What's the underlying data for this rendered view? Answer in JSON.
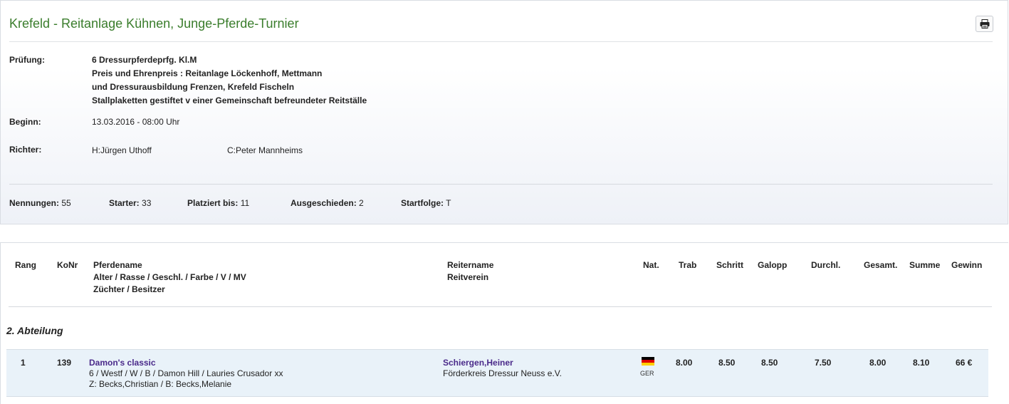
{
  "header": {
    "title": "Krefeld - Reitanlage Kühnen, Junge-Pferde-Turnier",
    "print_icon": "printer-icon"
  },
  "info": {
    "pruefung_label": "Prüfung:",
    "pruefung_lines": [
      "6 Dressurpferdeprfg. Kl.M",
      "Preis und Ehrenpreis : Reitanlage Löckenhoff, Mettmann",
      "und Dressurausbildung Frenzen, Krefeld Fischeln",
      "Stallplaketten gestiftet v einer Gemeinschaft befreundeter Reitställe"
    ],
    "beginn_label": "Beginn:",
    "beginn_value": "13.03.2016 - 08:00 Uhr",
    "richter_label": "Richter:",
    "richter_h": "H:Jürgen Uthoff",
    "richter_c": "C:Peter Mannheims"
  },
  "stats": {
    "nennungen_label": "Nennungen:",
    "nennungen_value": "55",
    "starter_label": "Starter:",
    "starter_value": "33",
    "platziert_label": "Platziert bis:",
    "platziert_value": "11",
    "ausgeschieden_label": "Ausgeschieden:",
    "ausgeschieden_value": "2",
    "startfolge_label": "Startfolge:",
    "startfolge_value": "T"
  },
  "table": {
    "headers": {
      "rang": "Rang",
      "konr": "KoNr",
      "pferd_1": "Pferdename",
      "pferd_2": "Alter / Rasse / Geschl. / Farbe / V / MV",
      "pferd_3": "Züchter / Besitzer",
      "reiter_1": "Reitername",
      "reiter_2": "Reitverein",
      "nat": "Nat.",
      "trab": "Trab",
      "schritt": "Schritt",
      "galopp": "Galopp",
      "durchl": "Durchl.",
      "gesamt": "Gesamt.",
      "summe": "Summe",
      "gewinn": "Gewinn"
    },
    "section_title": "2. Abteilung",
    "rows": [
      {
        "rang": "1",
        "konr": "139",
        "pferdename": "Damon's classic",
        "pferd_details": "6 / Westf / W / B / Damon Hill / Lauries Crusador xx",
        "zuechter": "Z: Becks,Christian / B: Becks,Melanie",
        "reitername": "Schiergen,Heiner",
        "reitverein": "Förderkreis Dressur Neuss e.V.",
        "nat": "GER",
        "flag_colors": [
          "#000000",
          "#dd0000",
          "#ffce00"
        ],
        "trab": "8.00",
        "schritt": "8.50",
        "galopp": "8.50",
        "durchl": "7.50",
        "gesamt": "8.00",
        "summe": "8.10",
        "gewinn": "66 €"
      }
    ]
  }
}
